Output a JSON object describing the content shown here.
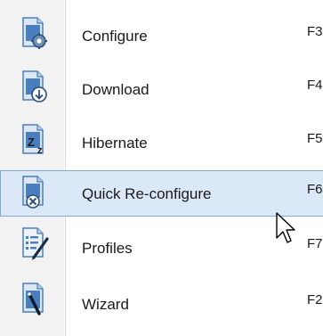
{
  "menu": {
    "items": [
      {
        "label": "Configure",
        "shortcut": "F3",
        "icon": "configure-gear-icon",
        "highlighted": false
      },
      {
        "label": "Download",
        "shortcut": "F4",
        "icon": "download-arrow-icon",
        "highlighted": false
      },
      {
        "label": "Hibernate",
        "shortcut": "F5",
        "icon": "hibernate-zz-icon",
        "highlighted": false
      },
      {
        "label": "Quick Re-configure",
        "shortcut": "F6",
        "icon": "quick-reconfigure-icon",
        "highlighted": true
      },
      {
        "label": "Profiles",
        "shortcut": "F7",
        "icon": "profiles-list-pencil-icon",
        "highlighted": false
      },
      {
        "label": "Wizard",
        "shortcut": "F2",
        "icon": "wizard-wand-icon",
        "highlighted": false
      }
    ]
  },
  "colors": {
    "highlight_bg": "#dbe8f7",
    "highlight_border": "#7ea9d8",
    "icon_blue": "#4a7fbf",
    "icon_dark": "#2b4f7a"
  }
}
